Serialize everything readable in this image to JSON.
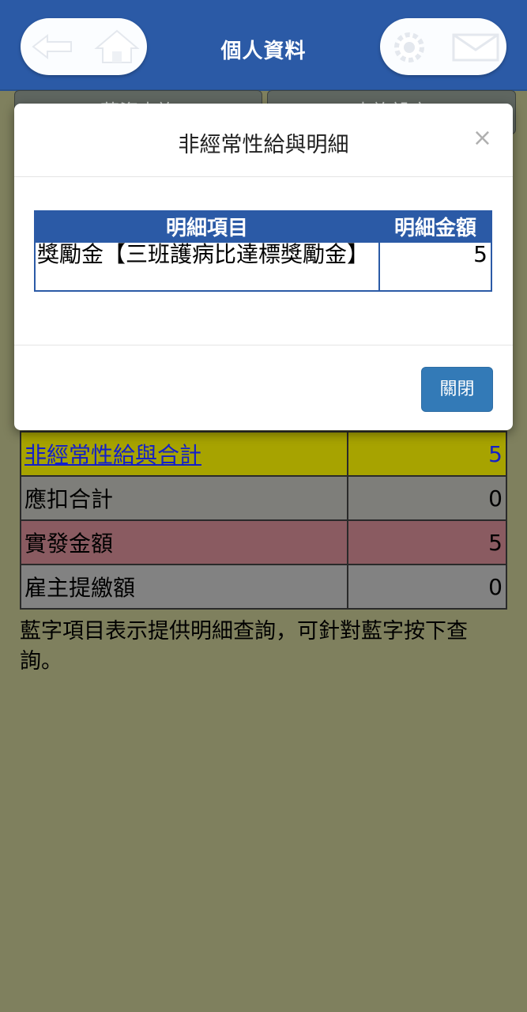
{
  "header": {
    "title": "個人資料"
  },
  "background_tabs": [
    "薪資查詢",
    "查詢設定"
  ],
  "summary": {
    "rows": [
      {
        "label": "非經常性給與合計",
        "value": "5"
      },
      {
        "label": "應扣合計",
        "value": "0"
      },
      {
        "label": "實發金額",
        "value": "5"
      },
      {
        "label": "雇主提繳額",
        "value": "0"
      }
    ],
    "note": "藍字項目表示提供明細查詢，可針對藍字按下查詢。"
  },
  "modal": {
    "title": "非經常性給與明細",
    "close_symbol": "×",
    "table": {
      "headers": [
        "明細項目",
        "明細金額"
      ],
      "rows": [
        {
          "item": "獎勵金【三班護病比達標獎勵金】",
          "amount": "5"
        }
      ]
    },
    "close_button": "關閉"
  },
  "colors": {
    "header_blue": "#2b5aa6",
    "button_blue": "#337ab7",
    "olive_row": "#a7a300",
    "red_row": "#8a5b61"
  }
}
